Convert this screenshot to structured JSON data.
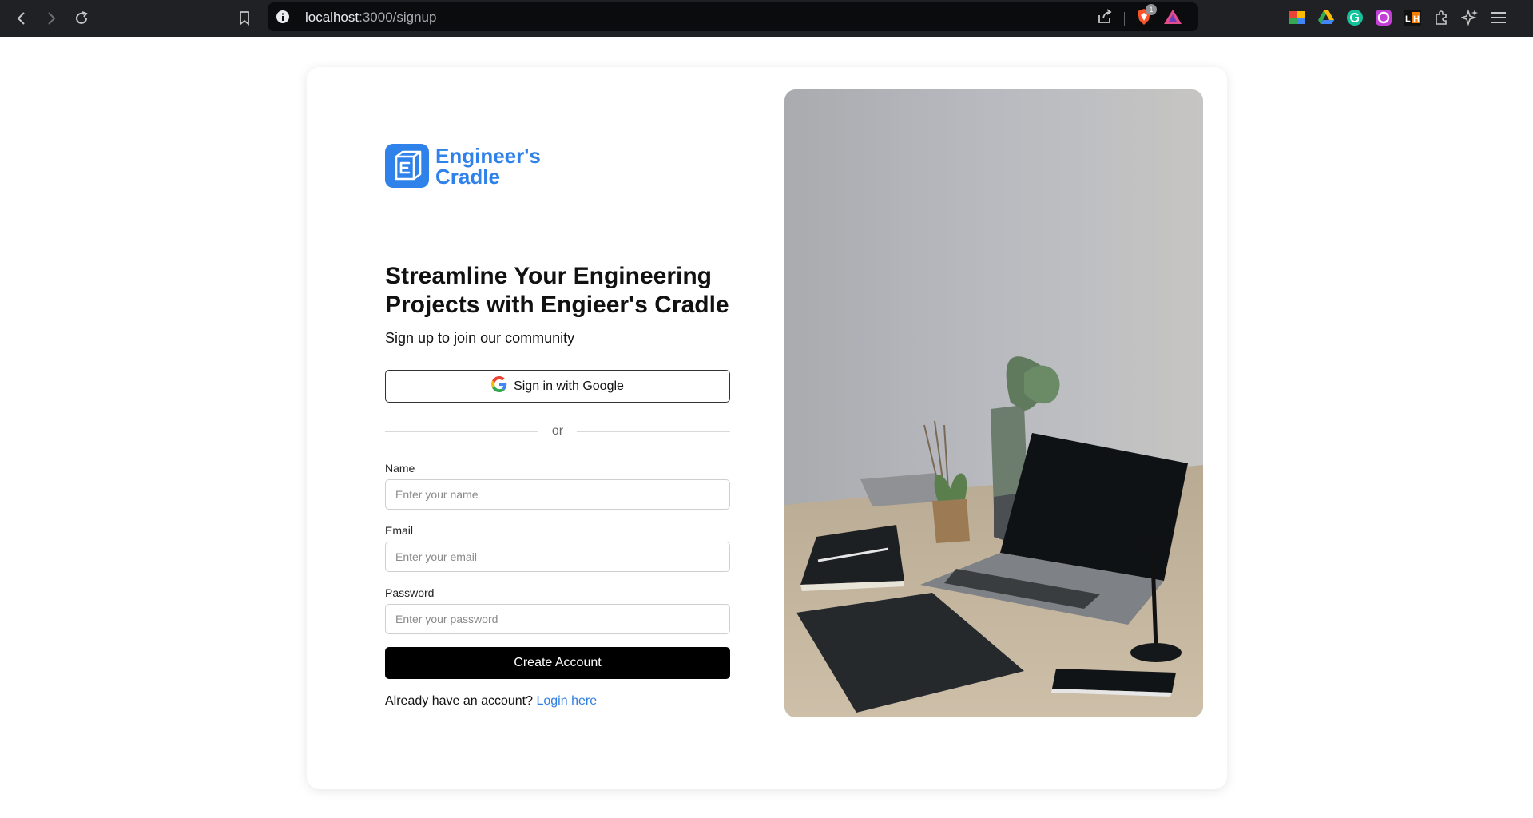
{
  "browser": {
    "url_host": "localhost",
    "url_path": ":3000/signup",
    "brave_badge_count": "1",
    "icons": [
      "back-icon",
      "forward-icon",
      "reload-icon",
      "bookmark-icon",
      "site-info-icon",
      "share-icon",
      "brave-shield-icon",
      "brave-rewards-icon"
    ],
    "extensions": [
      "color-ext-icon",
      "google-drive-icon",
      "grammarly-icon",
      "circle-ext-icon",
      "lh-ext-icon",
      "puzzle-extensions-icon",
      "sparkle-icon",
      "menu-icon"
    ]
  },
  "brand": {
    "name_line1": "Engineer's",
    "name_line2": "Cradle",
    "color": "#2f82ea"
  },
  "signup": {
    "headline": "Streamline Your Engineering Projects with Engieer's Cradle",
    "subheadline": "Sign up to join our community",
    "google_button": "Sign in with Google",
    "divider_text": "or",
    "name_label": "Name",
    "name_placeholder": "Enter your name",
    "email_label": "Email",
    "email_placeholder": "Enter your email",
    "password_label": "Password",
    "password_placeholder": "Enter your password",
    "submit_button": "Create Account",
    "login_prompt": "Already have an account?",
    "login_link": "Login here"
  },
  "colors": {
    "link": "#2f7de1",
    "button_bg": "#000000",
    "chrome_bg": "#202124"
  }
}
